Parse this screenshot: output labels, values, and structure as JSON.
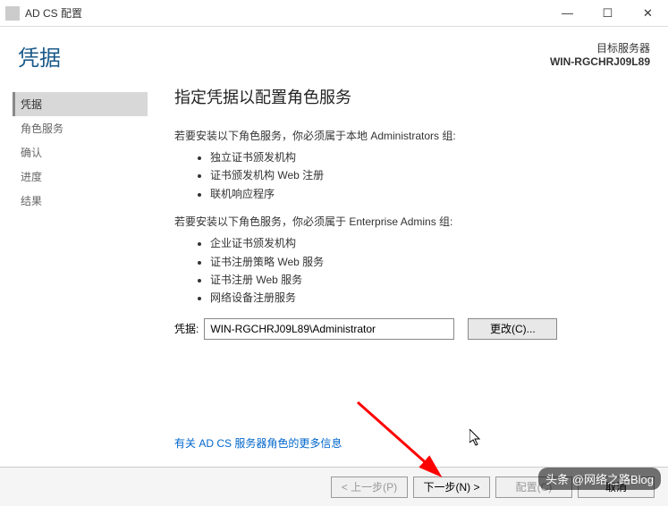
{
  "titlebar": {
    "title": "AD CS 配置"
  },
  "header": {
    "page_title": "凭据",
    "target_label": "目标服务器",
    "target_server": "WIN-RGCHRJ09L89"
  },
  "sidebar": {
    "items": [
      {
        "label": "凭据",
        "active": true
      },
      {
        "label": "角色服务",
        "active": false
      },
      {
        "label": "确认",
        "active": false
      },
      {
        "label": "进度",
        "active": false
      },
      {
        "label": "结果",
        "active": false
      }
    ]
  },
  "main": {
    "title": "指定凭据以配置角色服务",
    "group1_intro": "若要安装以下角色服务，你必须属于本地 Administrators 组:",
    "group1_items": [
      "独立证书颁发机构",
      "证书颁发机构 Web 注册",
      "联机响应程序"
    ],
    "group2_intro": "若要安装以下角色服务，你必须属于 Enterprise Admins 组:",
    "group2_items": [
      "企业证书颁发机构",
      "证书注册策略 Web 服务",
      "证书注册 Web 服务",
      "网络设备注册服务"
    ],
    "cred_label": "凭据:",
    "cred_value": "WIN-RGCHRJ09L89\\Administrator",
    "change_btn": "更改(C)...",
    "more_link": "有关 AD CS 服务器角色的更多信息"
  },
  "footer": {
    "prev": "< 上一步(P)",
    "next": "下一步(N) >",
    "config": "配置(C)",
    "cancel": "取消"
  },
  "watermark": "头条 @网络之路Blog"
}
